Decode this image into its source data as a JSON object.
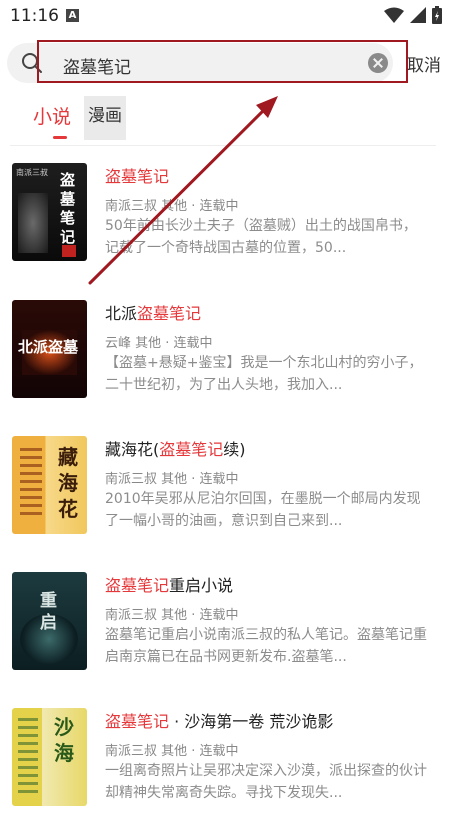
{
  "status_bar": {
    "time": "11:16",
    "notification_glyph": "A"
  },
  "search": {
    "query": "盗墓笔记",
    "cancel_label": "取消"
  },
  "tabs": [
    {
      "label": "小说"
    },
    {
      "label": "漫画"
    }
  ],
  "books": [
    {
      "cover_text": "盗墓笔记",
      "cover_top_text": "南派三叔",
      "title_parts": [
        {
          "text": "盗墓笔记",
          "hl": true
        }
      ],
      "meta": "南派三叔    其他 · 连载中",
      "desc": "50年前由长沙土夫子（盗墓贼）出土的战国帛书，记载了一个奇特战国古墓的位置，50..."
    },
    {
      "cover_text": "北派盗墓",
      "title_parts": [
        {
          "text": "北派",
          "hl": false
        },
        {
          "text": "盗墓笔记",
          "hl": true
        }
      ],
      "meta": "云峰      其他 · 连载中",
      "desc": "【盗墓+悬疑+鉴宝】我是一个东北山村的穷小子，二十世纪初，为了出人头地，我加入..."
    },
    {
      "cover_text": "藏海花",
      "title_parts": [
        {
          "text": "藏海花(",
          "hl": false
        },
        {
          "text": "盗墓笔记",
          "hl": true
        },
        {
          "text": "续)",
          "hl": false
        }
      ],
      "meta": "南派三叔    其他 · 连载中",
      "desc": "2010年吴邪从尼泊尔回国，在墨脱一个邮局内发现了一幅小哥的油画，意识到自己来到..."
    },
    {
      "cover_text": "重启",
      "title_parts": [
        {
          "text": "盗墓笔记",
          "hl": true
        },
        {
          "text": "重启小说",
          "hl": false
        }
      ],
      "meta": "南派三叔    其他 · 连载中",
      "desc": "盗墓笔记重启小说南派三叔的私人笔记。盗墓笔记重启南京篇已在品书网更新发布.盗墓笔..."
    },
    {
      "cover_text": "沙海",
      "title_parts": [
        {
          "text": "盗墓笔记",
          "hl": true
        },
        {
          "text": " · 沙海第一卷 荒沙诡影",
          "hl": false
        }
      ],
      "meta": "南派三叔    其他 · 连载中",
      "desc": "一组离奇照片让吴邪决定深入沙漠，派出探查的伙计却精神失常离奇失踪。寻找下发现失..."
    }
  ],
  "colors": {
    "accent": "#e5383b",
    "annotation": "#a01820"
  }
}
